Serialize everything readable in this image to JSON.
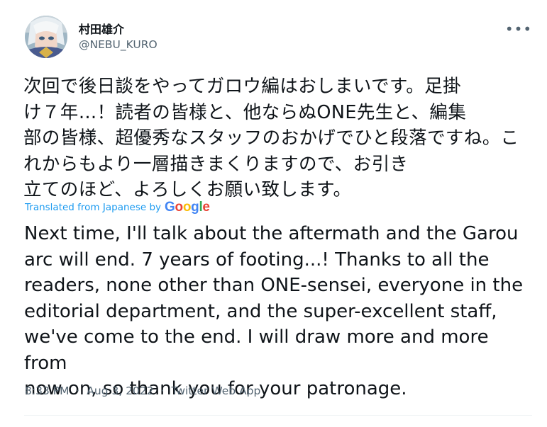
{
  "author": {
    "display_name": "村田雄介",
    "handle": "@NEBU_KURO"
  },
  "more_icon": "ellipsis-icon",
  "tweet": {
    "original_text": "次回で後日談をやってガロウ編はおしまいです。足掛\nけ７年…！読者の皆様と、他ならぬONE先生と、編集\n部の皆様、超優秀なスタッフのおかげでひと段落ですね。これからもより一層描きまくりますので、お引き\n立てのほど、よろしくお願い致します。",
    "translated_label": "Translated from Japanese by",
    "translation_provider": "Google",
    "translated_text": "Next time, I'll talk about the aftermath and the Garou\narc will end. 7 years of footing...! Thanks to all the\nreaders, none other than ONE-sensei, everyone in the\neditorial department, and the super-excellent staff,\nwe've come to the end. I will draw more and more from\nnow on, so thank you for your patronage."
  },
  "meta": {
    "time": "8:33 PM",
    "separator": "·",
    "date": "Aug 3, 2022",
    "source": "Twitter Web App"
  },
  "colors": {
    "link": "#1d9bf0",
    "secondary": "#536471",
    "text": "#0f1419"
  }
}
